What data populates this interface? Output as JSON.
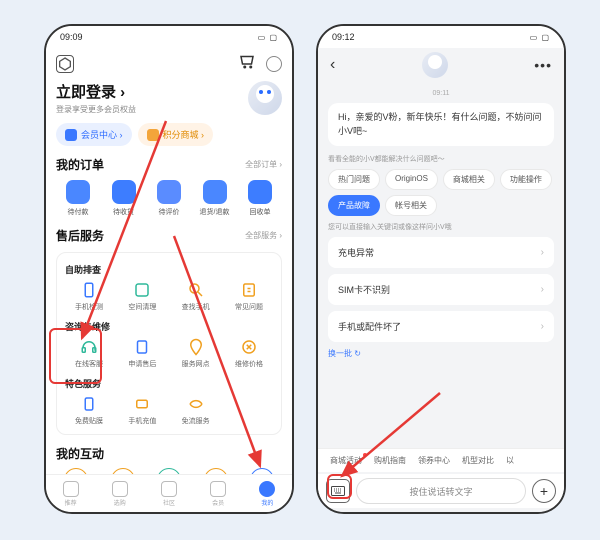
{
  "phone1": {
    "status": {
      "time": "09:09",
      "right": "▭ ▢"
    },
    "login": {
      "title": "立即登录 ›",
      "sub": "登录享受更多会员权益"
    },
    "pills": {
      "member": "会员中心 ›",
      "points": "积分商城 ›"
    },
    "orders": {
      "title": "我的订单",
      "more": "全部订单 ›",
      "items": [
        "待付款",
        "待收货",
        "待评价",
        "退货/退款",
        "回收单"
      ]
    },
    "service": {
      "title": "售后服务",
      "more": "全部服务 ›",
      "section1": {
        "title": "自助排查",
        "items": [
          "手机检测",
          "空间清理",
          "查找手机",
          "常见问题"
        ]
      },
      "section2": {
        "title": "咨询与维修",
        "items": [
          "在线客服",
          "申请售后",
          "服务网点",
          "维修价格"
        ]
      },
      "section3": {
        "title": "特色服务",
        "items": [
          "免费贴膜",
          "手机充值",
          "免流服务"
        ]
      }
    },
    "interact": {
      "title": "我的互动"
    },
    "nav": [
      "推荐",
      "选购",
      "社区",
      "会员",
      "我的"
    ]
  },
  "phone2": {
    "status": {
      "time": "09:12",
      "right": "▭ ▢"
    },
    "time_label": "09:11",
    "greeting": "Hi，亲爱的V粉，新年快乐！有什么问题，不妨问问小V吧~",
    "hint1": "看看全能的小V都能解决什么问题吧～",
    "chips": [
      "热门问题",
      "OriginOS",
      "商城相关",
      "功能操作",
      "产品故障",
      "帐号相关"
    ],
    "hint2": "您可以直接输入关键词或像这样问小V哦",
    "list": [
      "充电异常",
      "SIM卡不识别",
      "手机或配件坏了"
    ],
    "refresh": "换一批 ↻",
    "quick": [
      "商城活动",
      "购机指南",
      "领券中心",
      "机型对比",
      "以"
    ],
    "input": "按住说话转文字"
  }
}
